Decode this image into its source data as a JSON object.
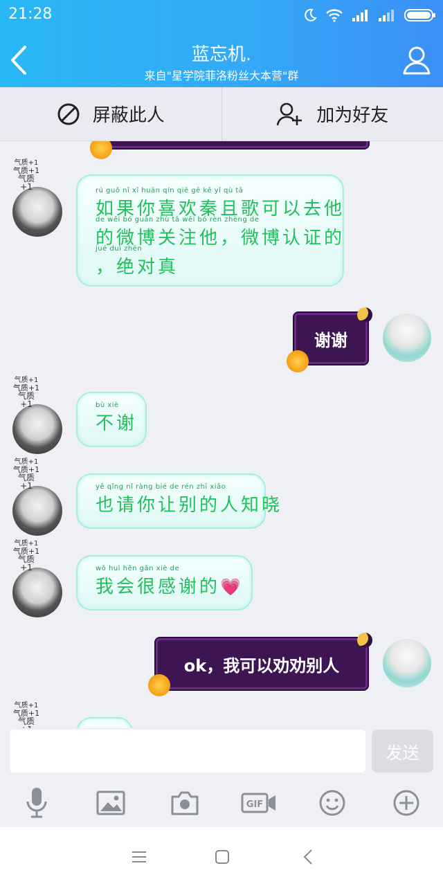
{
  "status": {
    "time": "21:28",
    "icons": [
      "moon-icon",
      "wifi-icon",
      "signal-icon",
      "signal-icon",
      "battery-icon"
    ]
  },
  "header": {
    "title": "蓝忘机.",
    "subtitle": "来自\"星学院菲洛粉丝大本营\"群"
  },
  "actions": {
    "block": "屏蔽此人",
    "add_friend": "加为好友"
  },
  "badge_text": "气质+1",
  "messages": [
    {
      "side": "left",
      "lines": [
        {
          "pinyin": "rú  guǒ  nǐ   xǐ  huān qín  qiě  gē   kě   yǐ   qù   tā",
          "hanzi": "如果你喜欢秦且歌可以去他"
        },
        {
          "pinyin": "de  wēi  bó  guān zhù  tā       wēi  bó  rèn zhèng de",
          "hanzi": "的微博关注他，微博认证的"
        },
        {
          "pinyin": "    jué  duì  zhēn",
          "hanzi": "，绝对真"
        }
      ]
    },
    {
      "side": "right",
      "text": "谢谢"
    },
    {
      "side": "left",
      "lines": [
        {
          "pinyin": "bù  xiè",
          "hanzi": "不谢"
        }
      ]
    },
    {
      "side": "left",
      "lines": [
        {
          "pinyin": "yě  qǐng  nǐ  ràng  bié  de   rén  zhī  xiǎo",
          "hanzi": "也请你让别的人知晓"
        }
      ]
    },
    {
      "side": "left",
      "lines": [
        {
          "pinyin": "wǒ  huì  hěn  gǎn  xiè  de",
          "hanzi": "我会很感谢的"
        }
      ],
      "emoji": "💗"
    },
    {
      "side": "right",
      "text": "ok，我可以劝劝别人"
    }
  ],
  "input": {
    "placeholder": "",
    "send": "发送"
  },
  "toolbar": [
    "mic-icon",
    "image-icon",
    "camera-icon",
    "gif-icon",
    "emoji-icon",
    "plus-icon"
  ],
  "colors": {
    "header_start": "#28b8f5",
    "header_end": "#3b8ff5",
    "bubble_green_text": "#22c05c",
    "bubble_purple": "#3c1552"
  }
}
